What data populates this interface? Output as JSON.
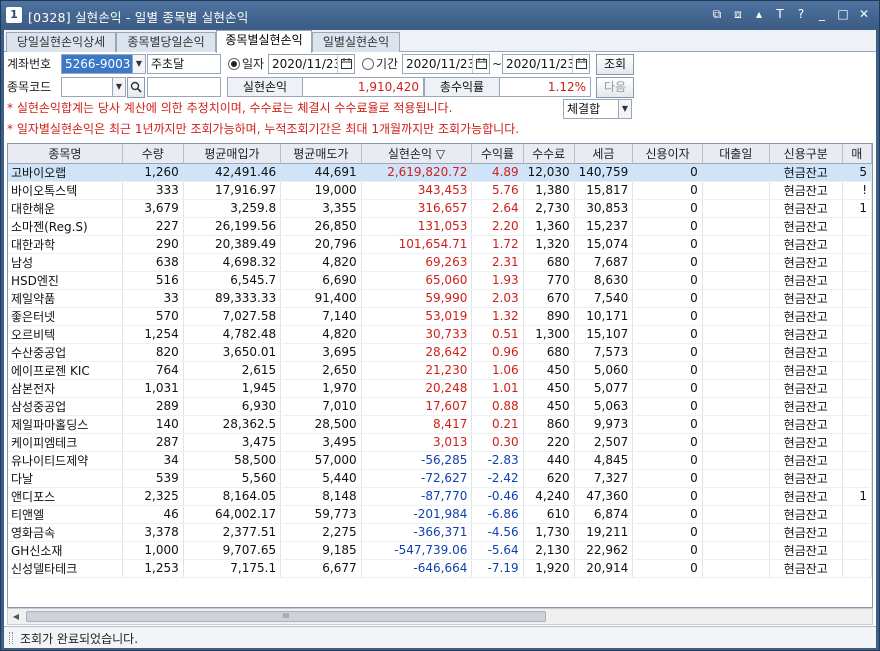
{
  "window": {
    "icon_label": "1",
    "title": "[0328] 실현손익 - 일별 종목별 실현손익",
    "buttons": [
      "⧉",
      "⧈",
      "▴",
      "T",
      "?",
      "_",
      "□",
      "✕"
    ]
  },
  "tabs": [
    {
      "label": "당일실현손익상세",
      "active": false
    },
    {
      "label": "종목별당일손익",
      "active": false
    },
    {
      "label": "종목별실현손익",
      "active": true
    },
    {
      "label": "일별실현손익",
      "active": false
    }
  ],
  "filters": {
    "account_label": "계좌번호",
    "account_value": "5266-9003",
    "account_name": "주초달",
    "mode_date_label": "일자",
    "mode_date_value": "2020/11/23",
    "mode_period_label": "기간",
    "period_from": "2020/11/23",
    "period_sep": "~",
    "period_to": "2020/11/23",
    "query_button": "조회",
    "stock_label": "종목코드",
    "stock_value": "",
    "stock_name": "",
    "next_button": "다음",
    "combo_value": "체결합"
  },
  "summary": {
    "pnl_label": "실현손익",
    "pnl_value": "1,910,420",
    "rate_label": "총수익률",
    "rate_value": "1.12%"
  },
  "notes": [
    "* 실현손익합계는 당사 계산에 의한 추정치이며, 수수료는 체결시 수수료율로 적용됩니다.",
    "* 일자별실현손익은 최근 1년까지만 조회가능하며, 누적조회기간은 최대 1개월까지만 조회가능합니다."
  ],
  "table": {
    "columns": [
      "종목명",
      "수량",
      "평균매입가",
      "평균매도가",
      "실현손익 ▽",
      "수익률",
      "수수료",
      "세금",
      "신용이자",
      "대출일",
      "신용구분",
      "매"
    ],
    "rows": [
      [
        "고바이오랩",
        "1,260",
        "42,491.46",
        "44,691",
        "2,619,820.72",
        "4.89",
        "12,030",
        "140,759",
        "0",
        "",
        "현금잔고",
        "5"
      ],
      [
        "바이오톡스텍",
        "333",
        "17,916.97",
        "19,000",
        "343,453",
        "5.76",
        "1,380",
        "15,817",
        "0",
        "",
        "현금잔고",
        "!"
      ],
      [
        "대한해운",
        "3,679",
        "3,259.8",
        "3,355",
        "316,657",
        "2.64",
        "2,730",
        "30,853",
        "0",
        "",
        "현금잔고",
        "1"
      ],
      [
        "소마젠(Reg.S)",
        "227",
        "26,199.56",
        "26,850",
        "131,053",
        "2.20",
        "1,360",
        "15,237",
        "0",
        "",
        "현금잔고",
        ""
      ],
      [
        "대한과학",
        "290",
        "20,389.49",
        "20,796",
        "101,654.71",
        "1.72",
        "1,320",
        "15,074",
        "0",
        "",
        "현금잔고",
        ""
      ],
      [
        "남성",
        "638",
        "4,698.32",
        "4,820",
        "69,263",
        "2.31",
        "680",
        "7,687",
        "0",
        "",
        "현금잔고",
        ""
      ],
      [
        "HSD엔진",
        "516",
        "6,545.7",
        "6,690",
        "65,060",
        "1.93",
        "770",
        "8,630",
        "0",
        "",
        "현금잔고",
        ""
      ],
      [
        "제일약품",
        "33",
        "89,333.33",
        "91,400",
        "59,990",
        "2.03",
        "670",
        "7,540",
        "0",
        "",
        "현금잔고",
        ""
      ],
      [
        "좋은터넷",
        "570",
        "7,027.58",
        "7,140",
        "53,019",
        "1.32",
        "890",
        "10,171",
        "0",
        "",
        "현금잔고",
        ""
      ],
      [
        "오르비텍",
        "1,254",
        "4,782.48",
        "4,820",
        "30,733",
        "0.51",
        "1,300",
        "15,107",
        "0",
        "",
        "현금잔고",
        ""
      ],
      [
        "수산중공업",
        "820",
        "3,650.01",
        "3,695",
        "28,642",
        "0.96",
        "680",
        "7,573",
        "0",
        "",
        "현금잔고",
        ""
      ],
      [
        "에이프로젠 KIC",
        "764",
        "2,615",
        "2,650",
        "21,230",
        "1.06",
        "450",
        "5,060",
        "0",
        "",
        "현금잔고",
        ""
      ],
      [
        "삼본전자",
        "1,031",
        "1,945",
        "1,970",
        "20,248",
        "1.01",
        "450",
        "5,077",
        "0",
        "",
        "현금잔고",
        ""
      ],
      [
        "삼성중공업",
        "289",
        "6,930",
        "7,010",
        "17,607",
        "0.88",
        "450",
        "5,063",
        "0",
        "",
        "현금잔고",
        ""
      ],
      [
        "제일파마홀딩스",
        "140",
        "28,362.5",
        "28,500",
        "8,417",
        "0.21",
        "860",
        "9,973",
        "0",
        "",
        "현금잔고",
        ""
      ],
      [
        "케이피엠테크",
        "287",
        "3,475",
        "3,495",
        "3,013",
        "0.30",
        "220",
        "2,507",
        "0",
        "",
        "현금잔고",
        ""
      ],
      [
        "유나이티드제약",
        "34",
        "58,500",
        "57,000",
        "-56,285",
        "-2.83",
        "440",
        "4,845",
        "0",
        "",
        "현금잔고",
        ""
      ],
      [
        "다날",
        "539",
        "5,560",
        "5,440",
        "-72,627",
        "-2.42",
        "620",
        "7,327",
        "0",
        "",
        "현금잔고",
        ""
      ],
      [
        "앤디포스",
        "2,325",
        "8,164.05",
        "8,148",
        "-87,770",
        "-0.46",
        "4,240",
        "47,360",
        "0",
        "",
        "현금잔고",
        "1"
      ],
      [
        "티앤엘",
        "46",
        "64,002.17",
        "59,773",
        "-201,984",
        "-6.86",
        "610",
        "6,874",
        "0",
        "",
        "현금잔고",
        ""
      ],
      [
        "영화금속",
        "3,378",
        "2,377.51",
        "2,275",
        "-366,371",
        "-4.56",
        "1,730",
        "19,211",
        "0",
        "",
        "현금잔고",
        ""
      ],
      [
        "GH신소재",
        "1,000",
        "9,707.65",
        "9,185",
        "-547,739.06",
        "-5.64",
        "2,130",
        "22,962",
        "0",
        "",
        "현금잔고",
        ""
      ],
      [
        "신성델타테크",
        "1,253",
        "7,175.1",
        "6,677",
        "-646,664",
        "-7.19",
        "1,920",
        "20,914",
        "0",
        "",
        "현금잔고",
        ""
      ]
    ]
  },
  "scrollbar": {
    "left_arrow": "◀",
    "thumb_grip": "III"
  },
  "status": {
    "message": "조회가 완료되었습니다."
  },
  "colors": {
    "positive": "#d0201a",
    "negative": "#1040b0",
    "selected_row": "#cfe4f8",
    "title_bar": "#3d5e86"
  }
}
